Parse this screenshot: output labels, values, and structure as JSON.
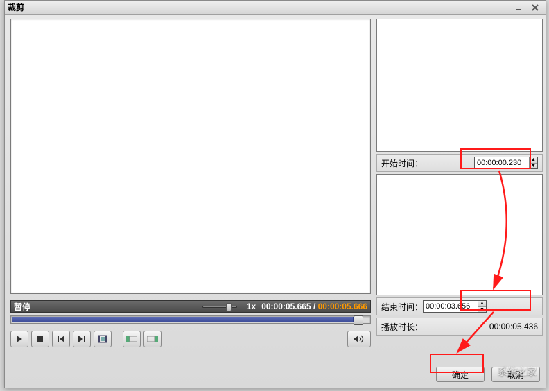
{
  "window": {
    "title": "裁剪"
  },
  "status": {
    "pause_label": "暂停",
    "speed": "1x",
    "current_time": "00:00:05.665",
    "total_time": "00:00:05.666"
  },
  "right": {
    "start_label": "开始时间：",
    "start_value": "00:00:00.230",
    "end_label": "结束时间：",
    "end_value": "00:00:03.656",
    "duration_label": "播放时长：",
    "duration_value": "00:00:05.436"
  },
  "buttons": {
    "ok": "确定",
    "cancel": "取消"
  },
  "icons": {
    "play": "play-icon",
    "stop": "stop-icon",
    "prev": "prev-icon",
    "next": "next-icon",
    "film": "film-icon",
    "markin": "mark-in-icon",
    "markout": "mark-out-icon",
    "volume": "volume-icon",
    "minimize": "minimize-icon",
    "close": "close-icon"
  }
}
